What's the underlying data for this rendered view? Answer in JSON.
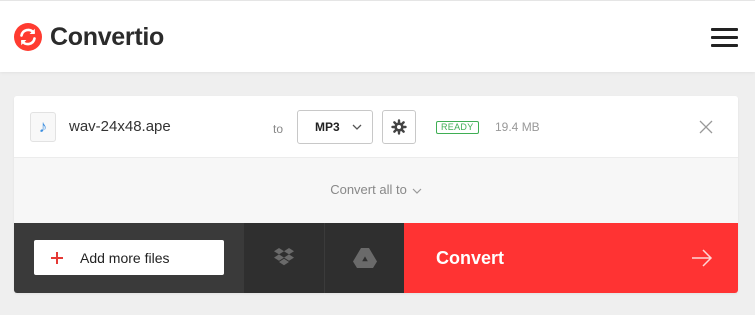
{
  "header": {
    "app_name": "Convertio",
    "logo_icon": "convertio-logo-icon",
    "menu_icon": "hamburger-menu-icon"
  },
  "file": {
    "type_icon": "music-note-icon",
    "name": "wav-24x48.ape",
    "to_label": "to",
    "target_format": "MP3",
    "settings_icon": "gear-icon",
    "status": "READY",
    "size": "19.4 MB",
    "remove_icon": "close-icon"
  },
  "convert_all": {
    "label": "Convert all to"
  },
  "actions": {
    "add_more_label": "Add more files",
    "dropbox_icon": "dropbox-icon",
    "gdrive_icon": "google-drive-icon",
    "convert_label": "Convert",
    "convert_arrow_icon": "arrow-right-icon"
  },
  "colors": {
    "brand_red": "#ff3333",
    "status_green": "#3fae54",
    "dark_panel": "#3a3a3a",
    "cloud_panel": "#2f2f2f"
  }
}
